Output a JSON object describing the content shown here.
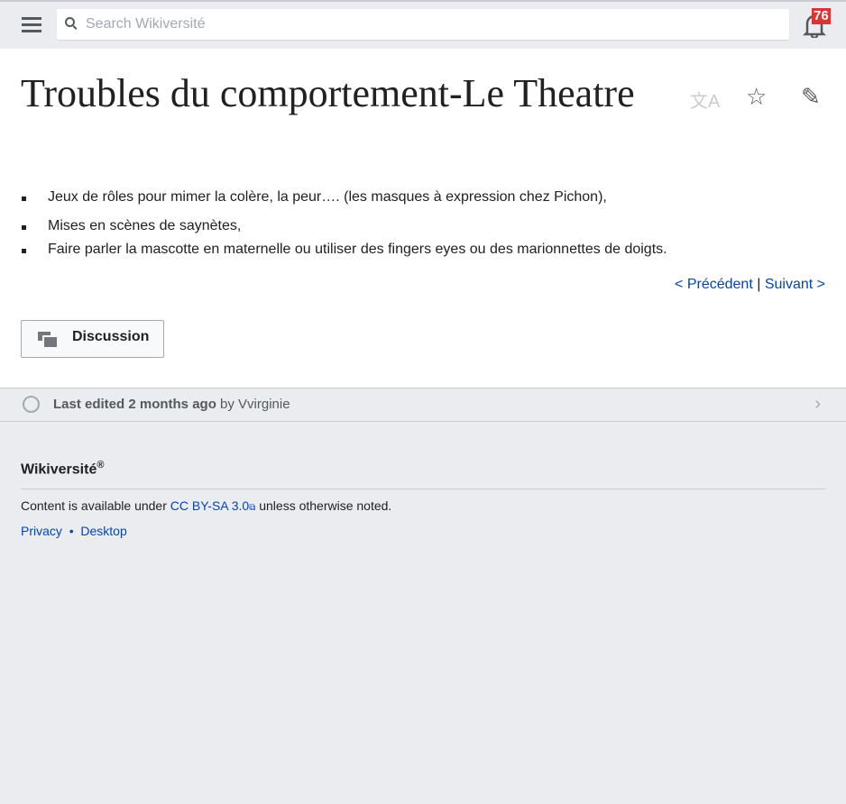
{
  "header": {
    "search_placeholder": "Search Wikiversité",
    "notification_count": "76"
  },
  "page": {
    "title": "Troubles du comportement-Le Theatre",
    "bullets": [
      "Jeux de rôles pour mimer la colère, la peur…. (les masques à expression chez Pichon),",
      "Mises en scènes de saynètes,",
      "Faire parler la mascotte en maternelle ou utiliser des fingers eyes ou des marionnettes de doigts."
    ],
    "prev": "< Précédent",
    "sep": "|",
    "next": "Suivant >",
    "discussion": "Discussion"
  },
  "last_edit": {
    "text": "Last edited 2 months ago",
    "by": "by",
    "user": "Vvirginie"
  },
  "footer": {
    "brand": "Wikiversité",
    "reg": "®",
    "license_pre": "Content is available under",
    "license_link": "CC BY-SA 3.0",
    "license_post": "unless otherwise noted.",
    "privacy": "Privacy",
    "bullet": "•",
    "desktop": "Desktop"
  }
}
